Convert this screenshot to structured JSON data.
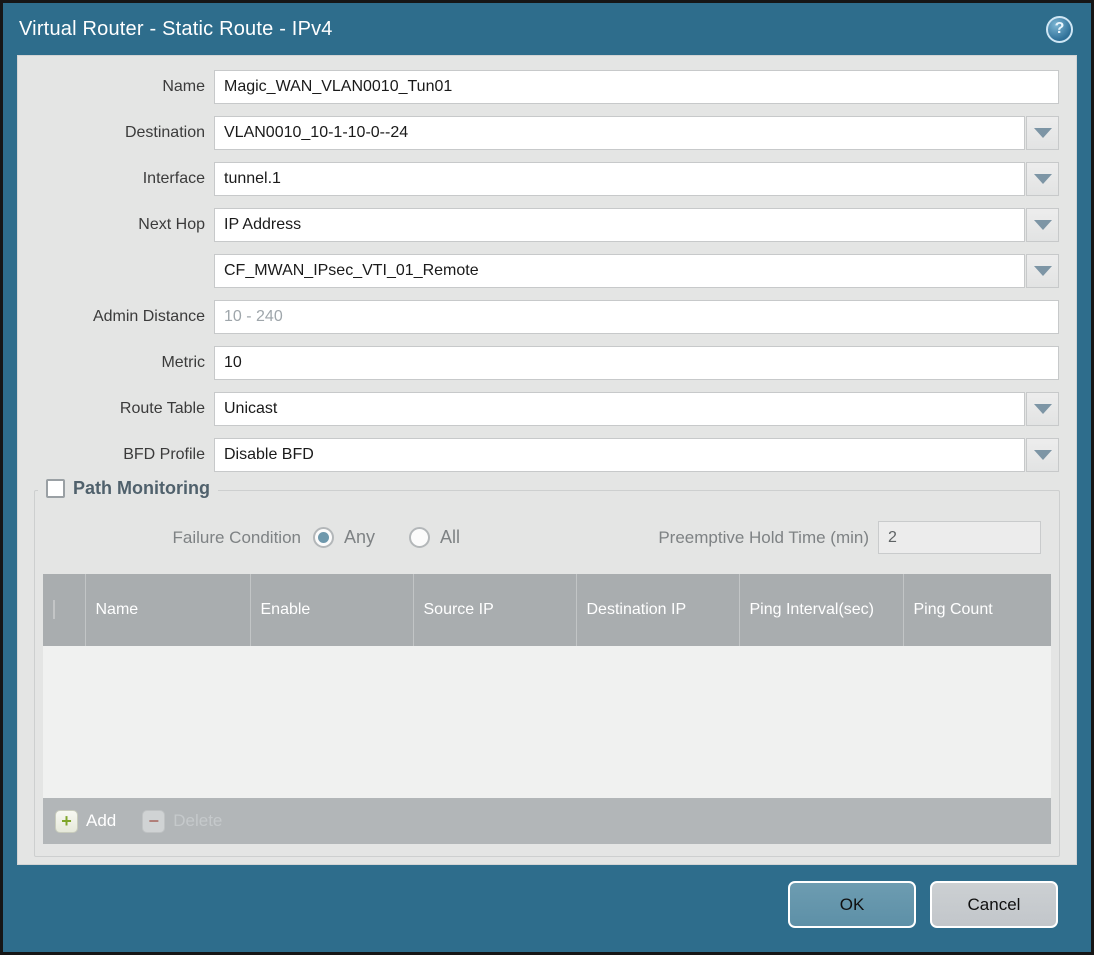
{
  "dialog": {
    "title": "Virtual Router - Static Route - IPv4",
    "help_glyph": "?"
  },
  "form": {
    "name": {
      "label": "Name",
      "value": "Magic_WAN_VLAN0010_Tun01"
    },
    "destination": {
      "label": "Destination",
      "value": "VLAN0010_10-1-10-0--24"
    },
    "interface": {
      "label": "Interface",
      "value": "tunnel.1"
    },
    "next_hop": {
      "label": "Next Hop",
      "value": "IP Address",
      "address_value": "CF_MWAN_IPsec_VTI_01_Remote"
    },
    "admin_distance": {
      "label": "Admin Distance",
      "value": "",
      "placeholder": "10 - 240"
    },
    "metric": {
      "label": "Metric",
      "value": "10"
    },
    "route_table": {
      "label": "Route Table",
      "value": "Unicast"
    },
    "bfd_profile": {
      "label": "BFD Profile",
      "value": "Disable BFD"
    }
  },
  "path_monitoring": {
    "title": "Path Monitoring",
    "enabled": false,
    "failure_condition": {
      "label": "Failure Condition",
      "options": [
        "Any",
        "All"
      ],
      "selected": "Any"
    },
    "preemptive_hold_time": {
      "label": "Preemptive Hold Time (min)",
      "value": "2"
    },
    "table": {
      "columns": [
        "Name",
        "Enable",
        "Source IP",
        "Destination IP",
        "Ping Interval(sec)",
        "Ping Count"
      ],
      "rows": []
    },
    "actions": {
      "add": "Add",
      "delete": "Delete",
      "delete_enabled": false
    }
  },
  "footer": {
    "ok": "OK",
    "cancel": "Cancel"
  },
  "colors": {
    "frame": "#2E6D8C",
    "content_bg": "#E4E5E4",
    "table_header_bg": "#A9ADAF",
    "action_bar_bg": "#B2B6B8",
    "ok_button": "#6397AD",
    "cancel_button": "#C7CBCF",
    "radio_selected_dot": "#6E98AC",
    "add_icon_green": "#7FA62B",
    "delete_icon_red": "#B0756E"
  }
}
